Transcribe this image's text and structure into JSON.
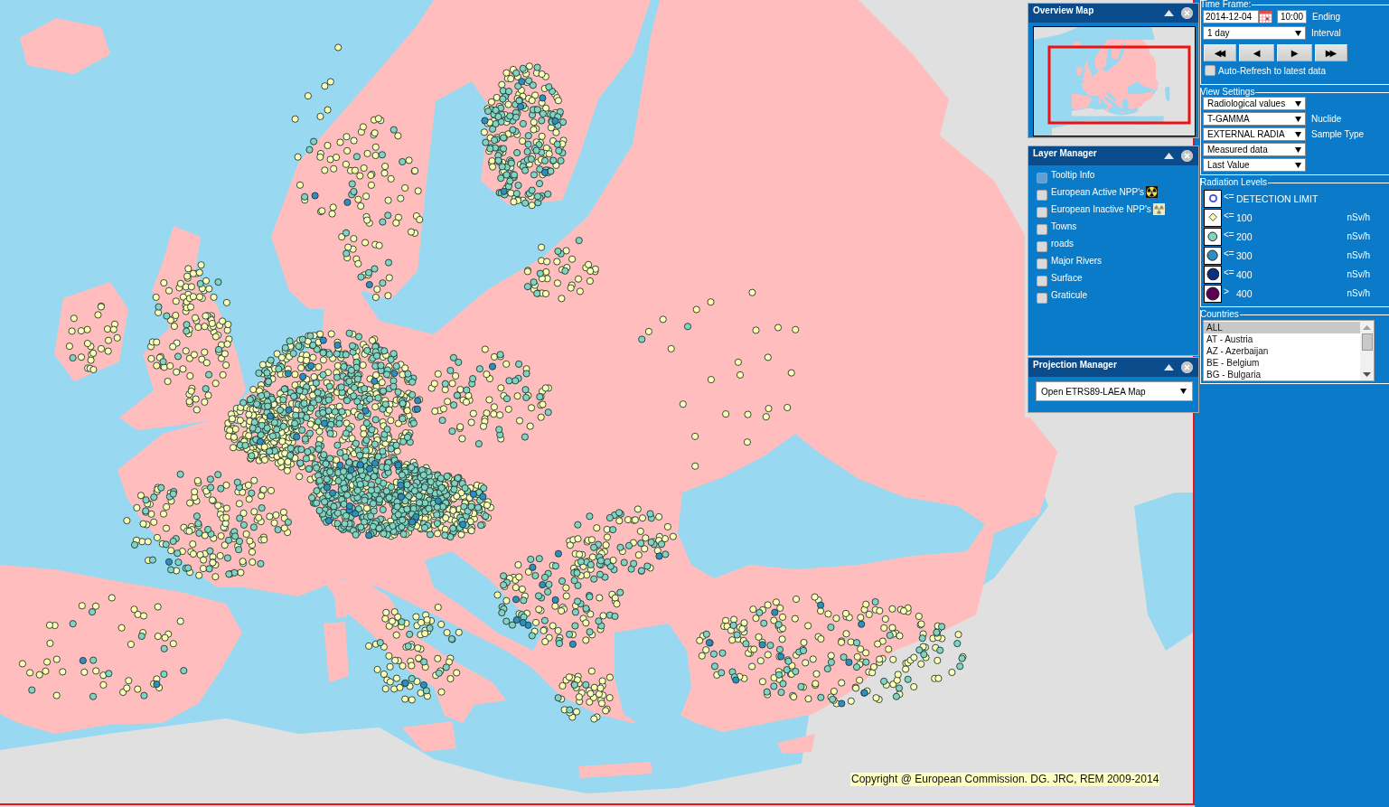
{
  "map": {
    "copyright": "Copyright @ European Commission. DG. JRC, REM 2009-2014"
  },
  "overview_map": {
    "title": "Overview Map"
  },
  "layer_manager": {
    "title": "Layer Manager",
    "layers": [
      {
        "label": "Tooltip Info",
        "kind": "plain",
        "checked": false,
        "disabled": true
      },
      {
        "label": "European Active NPP's",
        "kind": "active",
        "checked": false,
        "disabled": false
      },
      {
        "label": "European Inactive NPP's",
        "kind": "inactive",
        "checked": false,
        "disabled": false
      },
      {
        "label": "Towns",
        "kind": "plain",
        "checked": false,
        "disabled": false
      },
      {
        "label": "roads",
        "kind": "plain",
        "checked": false,
        "disabled": false
      },
      {
        "label": "Major Rivers",
        "kind": "plain",
        "checked": false,
        "disabled": false
      },
      {
        "label": "Surface",
        "kind": "plain",
        "checked": false,
        "disabled": false
      },
      {
        "label": "Graticule",
        "kind": "plain",
        "checked": false,
        "disabled": false
      }
    ]
  },
  "projection_manager": {
    "title": "Projection Manager",
    "selection": "Open ETRS89-LAEA Map"
  },
  "time_frame": {
    "legend": "Time Frame:",
    "date": "2014-12-04",
    "time": "10:00",
    "time_label": "Ending",
    "interval": "1 day",
    "interval_label": "Interval",
    "nav_buttons": [
      "◀◀",
      "◀",
      "▶",
      "▶▶"
    ],
    "auto_refresh": {
      "label": "Auto-Refresh to latest data",
      "checked": false
    }
  },
  "view_settings": {
    "legend": "View Settings",
    "selects": [
      {
        "value": "Radiological values"
      },
      {
        "value": "T-GAMMA",
        "label": "Nuclide"
      },
      {
        "value": "EXTERNAL RADIA",
        "label": "Sample Type"
      },
      {
        "value": "Measured data"
      },
      {
        "value": "Last Value"
      }
    ]
  },
  "radiation_levels": {
    "legend": "Radiation Levels",
    "levels": [
      {
        "op": "<=",
        "value": "DETECTION LIMIT",
        "kind": "outline",
        "color": "#4646e0"
      },
      {
        "op": "<=",
        "value": "100",
        "unit": "nSv/h",
        "kind": "diamond",
        "color": "#ffffb3"
      },
      {
        "op": "<=",
        "value": "200",
        "unit": "nSv/h",
        "kind": "circle",
        "color": "#80d4c0"
      },
      {
        "op": "<=",
        "value": "300",
        "unit": "nSv/h",
        "kind": "circle",
        "color": "#2e8fbf"
      },
      {
        "op": "<=",
        "value": "400",
        "unit": "nSv/h",
        "kind": "circle",
        "color": "#0d2f80"
      },
      {
        "op": ">",
        "value": "400",
        "unit": "nSv/h",
        "kind": "circle",
        "color": "#5c0055"
      }
    ]
  },
  "countries": {
    "legend": "Countries",
    "items": [
      {
        "label": "ALL",
        "selected": true
      },
      {
        "label": "AT - Austria",
        "selected": false
      },
      {
        "label": "AZ - Azerbaijan",
        "selected": false
      },
      {
        "label": "BE - Belgium",
        "selected": false
      },
      {
        "label": "BG - Bulgaria",
        "selected": false
      }
    ]
  }
}
